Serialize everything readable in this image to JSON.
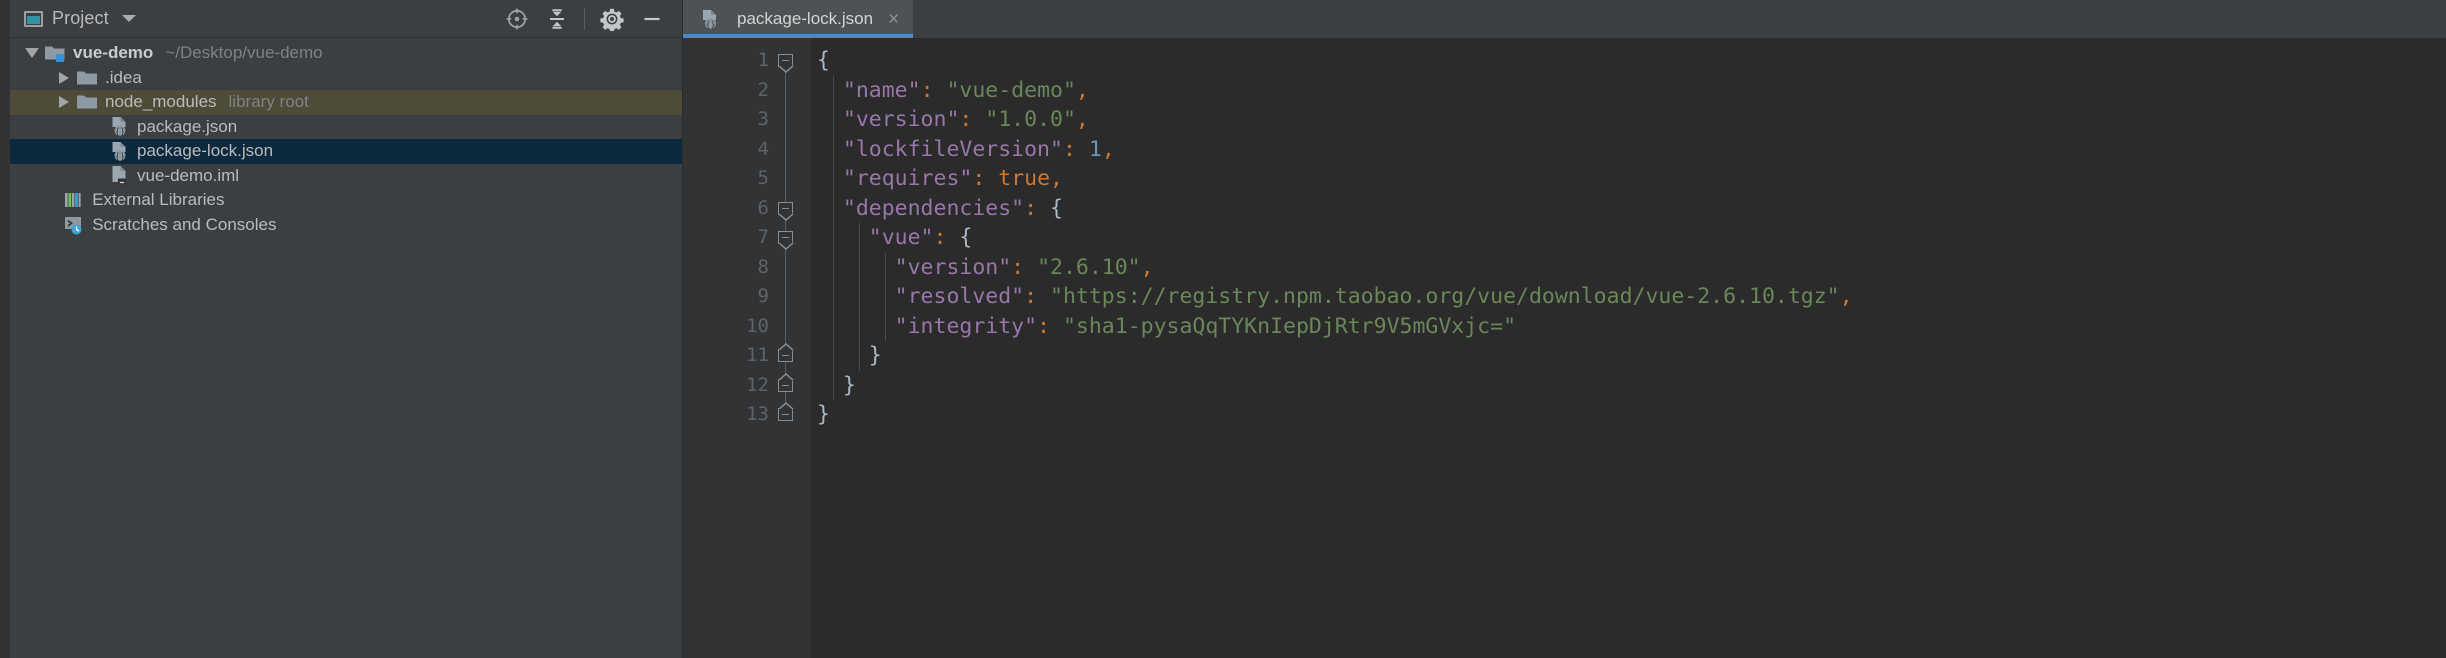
{
  "window": {
    "theme": "darcula"
  },
  "sidebar": {
    "title": "Project",
    "title_icon": "window-icon",
    "dropdown_icon": "chevron-down-icon",
    "actions": [
      {
        "name": "locate-icon",
        "label": "Select Opened File"
      },
      {
        "name": "collapse-all-icon",
        "label": "Collapse All"
      },
      {
        "name": "gear-icon",
        "label": "Settings"
      },
      {
        "name": "hide-icon",
        "label": "Hide"
      }
    ],
    "tree": [
      {
        "label": "vue-demo",
        "sub": "~/Desktop/vue-demo",
        "icon": "module-folder-icon",
        "indent": 0,
        "twisty": "down",
        "state": "normal",
        "bold": true
      },
      {
        "label": ".idea",
        "sub": "",
        "icon": "folder-icon",
        "indent": 1,
        "twisty": "right",
        "state": "normal",
        "bold": false
      },
      {
        "label": "node_modules",
        "sub": "library root",
        "icon": "folder-icon",
        "indent": 1,
        "twisty": "right",
        "state": "highlight",
        "bold": false
      },
      {
        "label": "package.json",
        "sub": "",
        "icon": "json-file-icon",
        "indent": 2,
        "twisty": "none",
        "state": "normal",
        "bold": false
      },
      {
        "label": "package-lock.json",
        "sub": "",
        "icon": "json-file-icon",
        "indent": 2,
        "twisty": "none",
        "state": "selected",
        "bold": false
      },
      {
        "label": "vue-demo.iml",
        "sub": "",
        "icon": "iml-file-icon",
        "indent": 2,
        "twisty": "none",
        "state": "normal",
        "bold": false
      },
      {
        "label": "External Libraries",
        "sub": "",
        "icon": "libraries-icon",
        "indent": 0.6,
        "twisty": "none",
        "state": "normal",
        "bold": false
      },
      {
        "label": "Scratches and Consoles",
        "sub": "",
        "icon": "scratches-icon",
        "indent": 0.6,
        "twisty": "none",
        "state": "normal",
        "bold": false
      }
    ]
  },
  "editor": {
    "tabs": [
      {
        "label": "package-lock.json",
        "icon": "json-file-icon",
        "active": true,
        "close_icon": "close-icon",
        "close_glyph": "×"
      }
    ],
    "line_numbers": [
      "1",
      "2",
      "3",
      "4",
      "5",
      "6",
      "7",
      "8",
      "9",
      "10",
      "11",
      "12",
      "13"
    ],
    "lines": [
      {
        "n": 1,
        "tokens": [
          {
            "t": "{",
            "c": "brace"
          }
        ]
      },
      {
        "n": 2,
        "tokens": [
          {
            "t": "  ",
            "c": "plain"
          },
          {
            "t": "\"name\"",
            "c": "key"
          },
          {
            "t": ":",
            "c": "punct"
          },
          {
            "t": " ",
            "c": "plain"
          },
          {
            "t": "\"vue-demo\"",
            "c": "str"
          },
          {
            "t": ",",
            "c": "punct"
          }
        ]
      },
      {
        "n": 3,
        "tokens": [
          {
            "t": "  ",
            "c": "plain"
          },
          {
            "t": "\"version\"",
            "c": "key"
          },
          {
            "t": ":",
            "c": "punct"
          },
          {
            "t": " ",
            "c": "plain"
          },
          {
            "t": "\"1.0.0\"",
            "c": "str"
          },
          {
            "t": ",",
            "c": "punct"
          }
        ]
      },
      {
        "n": 4,
        "tokens": [
          {
            "t": "  ",
            "c": "plain"
          },
          {
            "t": "\"lockfileVersion\"",
            "c": "key"
          },
          {
            "t": ":",
            "c": "punct"
          },
          {
            "t": " ",
            "c": "plain"
          },
          {
            "t": "1",
            "c": "num"
          },
          {
            "t": ",",
            "c": "punct"
          }
        ]
      },
      {
        "n": 5,
        "tokens": [
          {
            "t": "  ",
            "c": "plain"
          },
          {
            "t": "\"requires\"",
            "c": "key"
          },
          {
            "t": ":",
            "c": "punct"
          },
          {
            "t": " ",
            "c": "plain"
          },
          {
            "t": "true",
            "c": "bool"
          },
          {
            "t": ",",
            "c": "punct"
          }
        ]
      },
      {
        "n": 6,
        "tokens": [
          {
            "t": "  ",
            "c": "plain"
          },
          {
            "t": "\"dependencies\"",
            "c": "key"
          },
          {
            "t": ":",
            "c": "punct"
          },
          {
            "t": " ",
            "c": "plain"
          },
          {
            "t": "{",
            "c": "brace"
          }
        ]
      },
      {
        "n": 7,
        "tokens": [
          {
            "t": "    ",
            "c": "plain"
          },
          {
            "t": "\"vue\"",
            "c": "key"
          },
          {
            "t": ":",
            "c": "punct"
          },
          {
            "t": " ",
            "c": "plain"
          },
          {
            "t": "{",
            "c": "brace"
          }
        ]
      },
      {
        "n": 8,
        "tokens": [
          {
            "t": "      ",
            "c": "plain"
          },
          {
            "t": "\"version\"",
            "c": "key"
          },
          {
            "t": ":",
            "c": "punct"
          },
          {
            "t": " ",
            "c": "plain"
          },
          {
            "t": "\"2.6.10\"",
            "c": "str"
          },
          {
            "t": ",",
            "c": "punct"
          }
        ]
      },
      {
        "n": 9,
        "tokens": [
          {
            "t": "      ",
            "c": "plain"
          },
          {
            "t": "\"resolved\"",
            "c": "key"
          },
          {
            "t": ":",
            "c": "punct"
          },
          {
            "t": " ",
            "c": "plain"
          },
          {
            "t": "\"https://registry.npm.taobao.org/vue/download/vue-2.6.10.tgz\"",
            "c": "str"
          },
          {
            "t": ",",
            "c": "punct"
          }
        ]
      },
      {
        "n": 10,
        "tokens": [
          {
            "t": "      ",
            "c": "plain"
          },
          {
            "t": "\"integrity\"",
            "c": "key"
          },
          {
            "t": ":",
            "c": "punct"
          },
          {
            "t": " ",
            "c": "plain"
          },
          {
            "t": "\"sha1-pysaQqTYKnIepDjRtr9V5mGVxjc=\"",
            "c": "str"
          }
        ]
      },
      {
        "n": 11,
        "tokens": [
          {
            "t": "    ",
            "c": "plain"
          },
          {
            "t": "}",
            "c": "brace"
          }
        ]
      },
      {
        "n": 12,
        "tokens": [
          {
            "t": "  ",
            "c": "plain"
          },
          {
            "t": "}",
            "c": "brace"
          }
        ]
      },
      {
        "n": 13,
        "tokens": [
          {
            "t": "}",
            "c": "brace"
          }
        ]
      }
    ],
    "folds": [
      {
        "line": 1,
        "type": "open"
      },
      {
        "line": 6,
        "type": "open"
      },
      {
        "line": 7,
        "type": "open"
      },
      {
        "line": 11,
        "type": "close"
      },
      {
        "line": 12,
        "type": "close"
      },
      {
        "line": 13,
        "type": "close"
      }
    ],
    "file_name": "package-lock.json",
    "language": "json"
  },
  "colors": {
    "background": "#3c3f41",
    "editor_bg": "#2b2b2b",
    "gutter_bg": "#313335",
    "selection": "#0d293e",
    "highlight": "#4e4b38",
    "tab_active": "#4e5254",
    "tab_underline": "#4a88c7",
    "accent": "#4a88c7",
    "text": "#bbbbbb",
    "text_dim": "#7e8285",
    "json_key": "#9876aa",
    "json_string": "#6a8759",
    "json_number": "#6897bb",
    "json_punct": "#cc7832",
    "json_brace": "#a9b7c6",
    "line_number": "#606366"
  }
}
